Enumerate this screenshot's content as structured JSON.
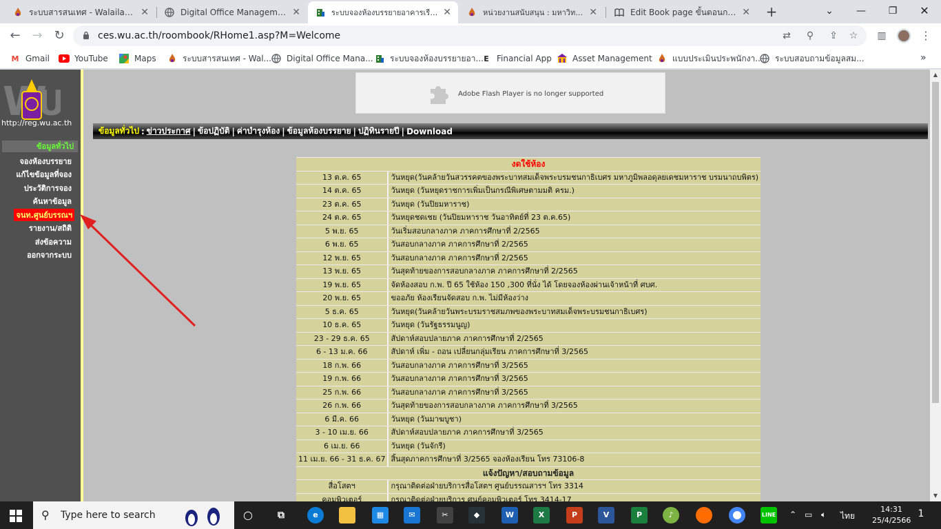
{
  "browser": {
    "tabs": [
      {
        "label": "ระบบสารสนเทศ - Walailak Univ",
        "icon": "wu-flame"
      },
      {
        "label": "Digital Office Management S",
        "icon": "globe"
      },
      {
        "label": "ระบบจองห้องบรรยายอาคารเรียนรว",
        "icon": "building"
      },
      {
        "label": "หน่วยงานสนับสนุน : มหาวิทยาลัย",
        "icon": "wu-flame"
      },
      {
        "label": "Edit Book page ขั้นตอนการปฏิ",
        "icon": "book"
      }
    ],
    "url": "ces.wu.ac.th/roombook/RHome1.asp?M=Welcome",
    "bookmarks": [
      {
        "label": "Gmail",
        "icon": "gmail"
      },
      {
        "label": "YouTube",
        "icon": "youtube"
      },
      {
        "label": "Maps",
        "icon": "maps"
      },
      {
        "label": "ระบบสารสนเทศ - Wal...",
        "icon": "wu-flame"
      },
      {
        "label": "Digital Office Mana...",
        "icon": "globe"
      },
      {
        "label": "ระบบจองห้องบรรยายอา...",
        "icon": "building"
      },
      {
        "label": "Financial App",
        "icon": "letter-e"
      },
      {
        "label": "Asset Management",
        "icon": "asset"
      },
      {
        "label": "แบบประเมินประพนักงา...",
        "icon": "wu-flame"
      },
      {
        "label": "ระบบสอบถามข้อมูลสม...",
        "icon": "globe"
      }
    ]
  },
  "page": {
    "logo_url": "http://reg.wu.ac.th",
    "nav_head": "ข้อมูลทั่วไป",
    "nav_items": [
      {
        "label": "จองห้องบรรยาย",
        "highlight": false
      },
      {
        "label": "แก้ไขข้อมูลที่จอง",
        "highlight": false
      },
      {
        "label": "ประวัติการจอง",
        "highlight": false
      },
      {
        "label": "ค้นหาข้อมูล",
        "highlight": false
      },
      {
        "label": "จนท.ศูนย์บรรณฯ",
        "highlight": true
      },
      {
        "label": "รายงาน/สถิติ",
        "highlight": false
      },
      {
        "label": "ส่งข้อความ",
        "highlight": false
      },
      {
        "label": "ออกจากระบบ",
        "highlight": false
      }
    ],
    "flash_message": "Adobe Flash Player is no longer supported",
    "menubar": {
      "head": "ข้อมูลทั่วไป",
      "links": [
        "ข่าวประกาศ",
        "ข้อปฏิบัติ",
        "ค่าบำรุงห้อง",
        "ข้อมูลห้องบรรยาย",
        "ปฏิทินรายปี",
        "Download"
      ]
    },
    "closed_header": "งดใช้ห้อง",
    "closed_rows": [
      {
        "date": "13 ต.ค. 65",
        "text": "วันหยุด(วันคล้ายวันสวรรคตของพระบาทสมเด็จพระบรมชนกาธิเบศร มหาภูมิพลอดุลยเดชมหาราช บรมนาถบพิตร)"
      },
      {
        "date": "14 ต.ค. 65",
        "text": "วันหยุด (วันหยุดราชการเพิ่มเป็นกรณีพิเศษตามมติ ครม.)"
      },
      {
        "date": "23 ต.ค. 65",
        "text": "วันหยุด (วันปิยมหาราช)"
      },
      {
        "date": "24 ต.ค. 65",
        "text": "วันหยุดชดเชย (วันปิยมหาราช วันอาทิตย์ที่ 23 ต.ค.65)"
      },
      {
        "date": "5 พ.ย. 65",
        "text": "วันเริ่มสอบกลางภาค ภาคการศึกษาที่ 2/2565"
      },
      {
        "date": "6 พ.ย. 65",
        "text": "วันสอบกลางภาค ภาคการศึกษาที่ 2/2565"
      },
      {
        "date": "12 พ.ย. 65",
        "text": "วันสอบกลางภาค ภาคการศึกษาที่ 2/2565"
      },
      {
        "date": "13 พ.ย. 65",
        "text": "วันสุดท้ายของการสอบกลางภาค ภาคการศึกษาที่ 2/2565"
      },
      {
        "date": "19 พ.ย. 65",
        "text": "จัดห้องสอบ ก.พ. ปี 65 ใช้ห้อง 150 ,300 ที่นั่ง ได้ โดยจองห้องผ่านเจ้าหน้าที่ ศบศ."
      },
      {
        "date": "20 พ.ย. 65",
        "text": "ขออภัย ห้องเรียนจัดสอบ ก.พ. ไม่มีห้องว่าง"
      },
      {
        "date": "5 ธ.ค. 65",
        "text": "วันหยุด(วันคล้ายวันพระบรมราชสมภพของพระบาทสมเด็จพระบรมชนกาธิเบศร)"
      },
      {
        "date": "10 ธ.ค. 65",
        "text": "วันหยุด (วันรัฐธรรมนูญ)"
      },
      {
        "date": "23 - 29 ธ.ค. 65",
        "text": "สัปดาห์สอบปลายภาค ภาคการศึกษาที่ 2/2565"
      },
      {
        "date": "6 - 13 ม.ค. 66",
        "text": "สัปดาห์ เพิ่ม - ถอน เปลี่ยนกลุ่มเรียน ภาคการศึกษาที่ 3/2565"
      },
      {
        "date": "18 ก.พ. 66",
        "text": "วันสอบกลางภาค ภาคการศึกษาที่ 3/2565"
      },
      {
        "date": "19 ก.พ. 66",
        "text": "วันสอบกลางภาค ภาคการศึกษาที่ 3/2565"
      },
      {
        "date": "25 ก.พ. 66",
        "text": "วันสอบกลางภาค ภาคการศึกษาที่ 3/2565"
      },
      {
        "date": "26 ก.พ. 66",
        "text": "วันสุดท้ายของการสอบกลางภาค ภาคการศึกษาที่ 3/2565"
      },
      {
        "date": "6 มี.ค. 66",
        "text": "วันหยุด (วันมาฆบูชา)"
      },
      {
        "date": "3 - 10 เม.ย. 66",
        "text": "สัปดาห์สอบปลายภาค ภาคการศึกษาที่ 3/2565"
      },
      {
        "date": "6 เม.ย. 66",
        "text": "วันหยุด (วันจักรี)"
      },
      {
        "date": "11 เม.ย. 66 - 31 ธ.ค. 67",
        "text": "สิ้นสุดภาคการศึกษาที่ 3/2565 จองห้องเรียน โทร 73106-8"
      }
    ],
    "contact_header": "แจ้งปัญหา/สอบถามข้อมูล",
    "contact_rows": [
      {
        "date": "สื่อโสตฯ",
        "text": "กรุณาติดต่อฝ่ายบริการสื่อโสตฯ ศูนย์บรรณสารฯ โทร 3314"
      },
      {
        "date": "คอมพิวเตอร์",
        "text": "กรุณาติดต่อฝ่ายบริการ ศูนย์คอมพิวเตอร์ โทร 3414-17"
      }
    ]
  },
  "taskbar": {
    "search_placeholder": "Type here to search",
    "lang": "ไทย",
    "time": "14:31",
    "date": "25/4/2566",
    "notifications": "1"
  }
}
